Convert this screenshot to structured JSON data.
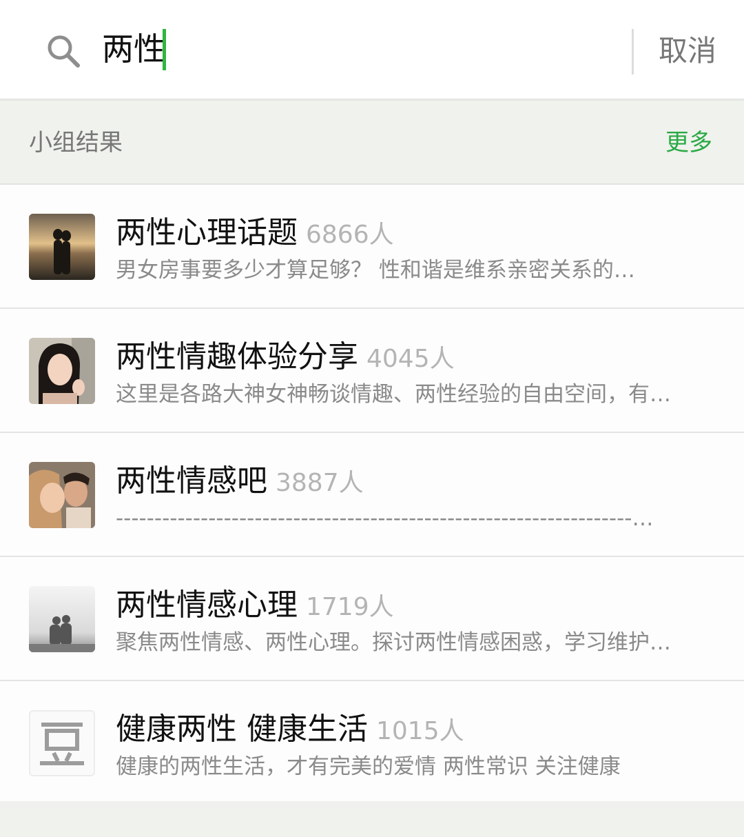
{
  "search": {
    "query": "两性",
    "cancel_label": "取消"
  },
  "section": {
    "title": "小组结果",
    "more_label": "更多"
  },
  "results": [
    {
      "name": "两性心理话题",
      "members": "6866人",
      "description": "男女房事要多少才算足够？ 性和谐是维系亲密关系的…"
    },
    {
      "name": "两性情趣体验分享",
      "members": "4045人",
      "description": "这里是各路大神女神畅谈情趣、两性经验的自由空间，有…"
    },
    {
      "name": "两性情感吧",
      "members": "3887人",
      "description": "-------------------------------------------------------------------…"
    },
    {
      "name": "两性情感心理",
      "members": "1719人",
      "description": "聚焦两性情感、两性心理。探讨两性情感困惑，学习维护…"
    },
    {
      "name": "健康两性 健康生活",
      "members": "1015人",
      "description": "健康的两性生活，才有完美的爱情 两性常识 关注健康"
    },
    {
      "logo_text": "豆"
    }
  ],
  "colors": {
    "accent_green": "#2aa945",
    "caret_green": "#2fb640",
    "muted_text": "#8a8a8a"
  },
  "icons": {
    "search": "magnifier-icon"
  }
}
